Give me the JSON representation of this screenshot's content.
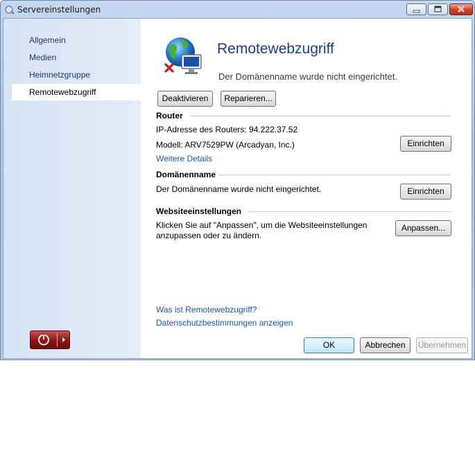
{
  "window": {
    "title": "Servereinstellungen"
  },
  "sidebar": {
    "items": [
      {
        "label": "Allgemein"
      },
      {
        "label": "Medien"
      },
      {
        "label": "Heimnetzgruppe"
      },
      {
        "label": "Remotewebzugriff",
        "selected": true
      }
    ]
  },
  "main": {
    "title": "Remotewebzugriff",
    "status": "Der Domänenname wurde nicht eingerichtet.",
    "actions": {
      "deactivate_label": "Deaktivieren",
      "repair_label": "Reparieren..."
    },
    "router": {
      "title": "Router",
      "ip_line": "IP-Adresse des Routers: 94.222.37.52",
      "model_line": "Modell: ARV7529PW (Arcadyan, Inc.)",
      "setup_label": "Einrichten",
      "details_link": "Weitere Details"
    },
    "domain": {
      "title": "Domänenname",
      "text": "Der Domänenname wurde nicht eingerichtet.",
      "setup_label": "Einrichten"
    },
    "website": {
      "title": "Websiteeinstellungen",
      "text_line1": "Klicken Sie auf \"Anpassen\", um die Websiteeinstellungen",
      "text_line2": "anzupassen oder zu ändern.",
      "customize_label": "Anpassen..."
    },
    "links": {
      "what_is": "Was ist Remotewebzugriff?",
      "privacy": "Datenschutzbestimmungen anzeigen"
    }
  },
  "footer": {
    "ok_label": "OK",
    "cancel_label": "Abbrechen",
    "apply_label": "Übernehmen"
  },
  "icons": {
    "title": "server-settings-icon",
    "globe": "globe-computer-error-icon",
    "power": "power-icon",
    "arrow": "arrow-right-icon"
  },
  "colors": {
    "heading": "#1b3f8b",
    "link": "#1d57a6",
    "sidebar": "#dde7f6",
    "power_button": "#8c1414"
  }
}
